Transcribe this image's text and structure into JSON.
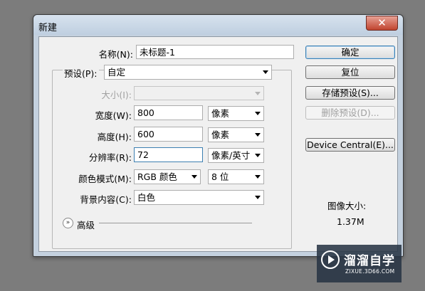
{
  "window": {
    "title": "新建",
    "close_glyph": "✕"
  },
  "form": {
    "name_label": "名称(N):",
    "name_value": "未标题-1",
    "preset_label": "预设(P):",
    "preset_value": "自定",
    "size_label": "大小(I):",
    "size_value": "",
    "width_label": "宽度(W):",
    "width_value": "800",
    "width_unit": "像素",
    "height_label": "高度(H):",
    "height_value": "600",
    "height_unit": "像素",
    "resolution_label": "分辨率(R):",
    "resolution_value": "72",
    "resolution_unit": "像素/英寸",
    "color_mode_label": "颜色模式(M):",
    "color_mode_value": "RGB 颜色",
    "bit_depth_value": "8 位",
    "background_label": "背景内容(C):",
    "background_value": "白色",
    "advanced_label": "高级",
    "advanced_icon": "chevron-double-down-icon"
  },
  "buttons": {
    "ok": "确定",
    "reset": "复位",
    "save_preset": "存储预设(S)...",
    "delete_preset": "删除预设(D)...",
    "device_central": "Device Central(E)..."
  },
  "info": {
    "image_size_label": "图像大小:",
    "image_size_value": "1.37M"
  },
  "watermark": {
    "name": "溜溜自学",
    "url": "ZIXUE.3D66.COM"
  }
}
